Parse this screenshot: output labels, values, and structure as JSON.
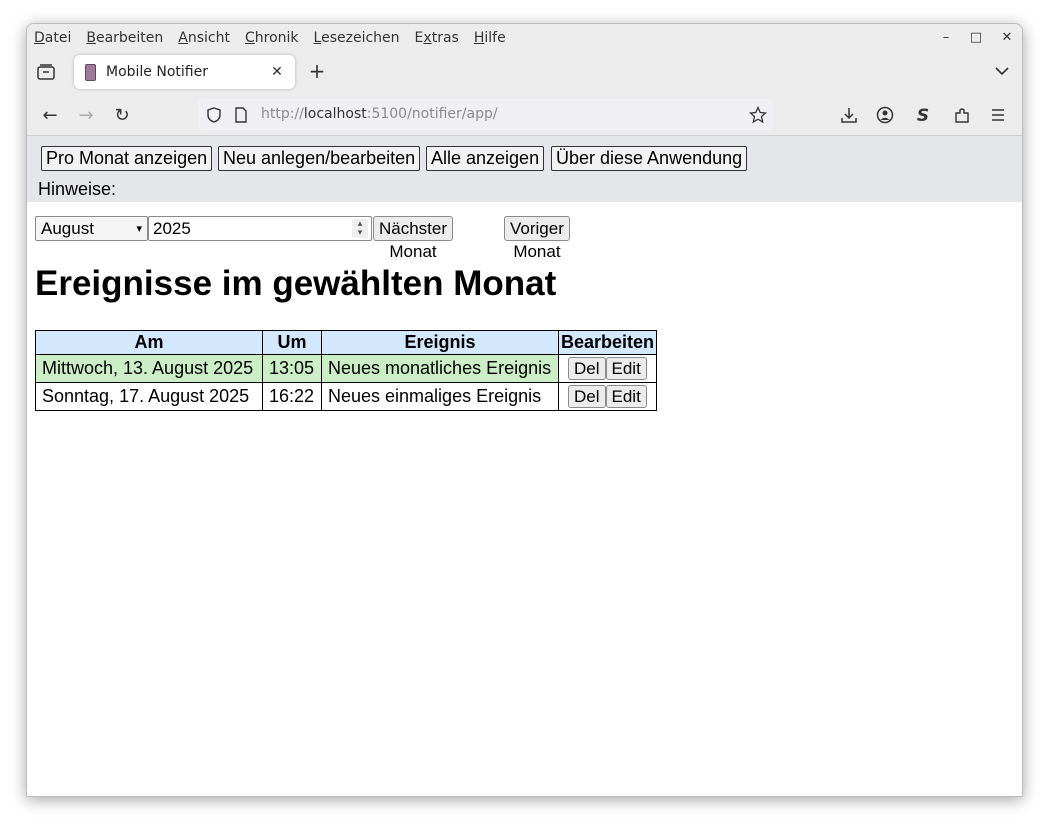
{
  "browser": {
    "menu": [
      {
        "pre": "",
        "u": "D",
        "post": "atei"
      },
      {
        "pre": "",
        "u": "B",
        "post": "earbeiten"
      },
      {
        "pre": "",
        "u": "A",
        "post": "nsicht"
      },
      {
        "pre": "",
        "u": "C",
        "post": "hronik"
      },
      {
        "pre": "",
        "u": "L",
        "post": "esezeichen"
      },
      {
        "pre": "E",
        "u": "x",
        "post": "tras"
      },
      {
        "pre": "",
        "u": "H",
        "post": "ilfe"
      }
    ],
    "tab_title": "Mobile Notifier",
    "url_prefix": "http://",
    "url_host": "localhost",
    "url_suffix": ":5100/notifier/app/"
  },
  "nav": {
    "buttons": [
      "Pro Monat anzeigen",
      "Neu anlegen/bearbeiten",
      "Alle anzeigen",
      "Über diese Anwendung"
    ],
    "hint_label": "Hinweise:"
  },
  "controls": {
    "month": "August",
    "year": "2025",
    "next_label": "Nächster Monat",
    "prev_label": "Voriger Monat"
  },
  "heading": "Ereignisse im gewählten Monat",
  "table": {
    "headers": [
      "Am",
      "Um",
      "Ereignis",
      "Bearbeiten"
    ],
    "rows": [
      {
        "date": "Mittwoch, 13. August 2025",
        "time": "13:05",
        "event": "Neues monatliches Ereignis",
        "del": "Del",
        "edit": "Edit"
      },
      {
        "date": "Sonntag, 17. August 2025",
        "time": "16:22",
        "event": "Neues einmaliges Ereignis",
        "del": "Del",
        "edit": "Edit"
      }
    ]
  },
  "colors": {
    "header_bg": "#d3e8fd",
    "recurring_row_bg": "#cbeec6",
    "nav_bg": "#e5e6e9"
  }
}
